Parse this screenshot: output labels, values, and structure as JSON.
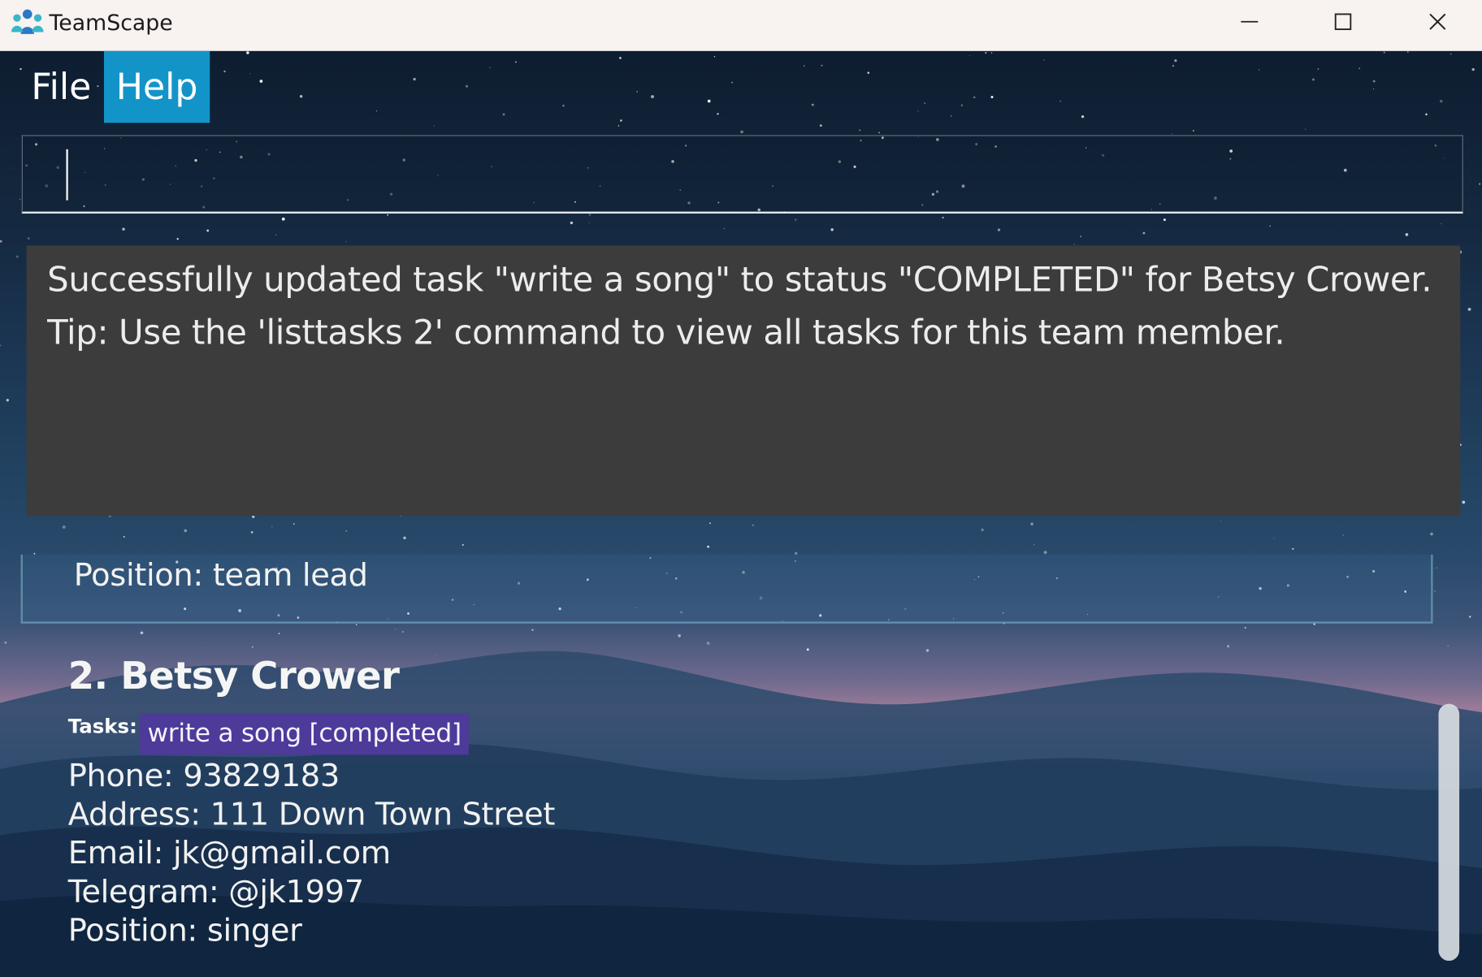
{
  "window": {
    "title": "TeamScape",
    "controls": [
      "minimize",
      "maximize",
      "close"
    ]
  },
  "menu": {
    "items": [
      {
        "label": "File",
        "active": false
      },
      {
        "label": "Help",
        "active": true
      }
    ],
    "accent_color": "#1394c8"
  },
  "command": {
    "value": "",
    "placeholder": ""
  },
  "result": {
    "lines": [
      "Successfully updated task \"write a song\" to status \"COMPLETED\" for Betsy Crower.",
      "Tip: Use the 'listtasks 2' command to view all tasks for this team member."
    ],
    "background_color": "#3c3c3c"
  },
  "persons": [
    {
      "visible_fields": {
        "position": "Position: team lead"
      }
    },
    {
      "index_name": "2. Betsy Crower",
      "tasks_label": "Tasks:",
      "tasks": [
        "write a song [completed]"
      ],
      "task_color": "#4d3a99",
      "phone": "Phone: 93829183",
      "address": "Address: 111 Down Town Street",
      "email": "Email: jk@gmail.com",
      "telegram": "Telegram: @jk1997",
      "position": "Position: singer"
    }
  ],
  "icons": {
    "app": "team-people-icon",
    "minimize": "minimize-icon",
    "maximize": "maximize-icon",
    "close": "close-icon"
  }
}
